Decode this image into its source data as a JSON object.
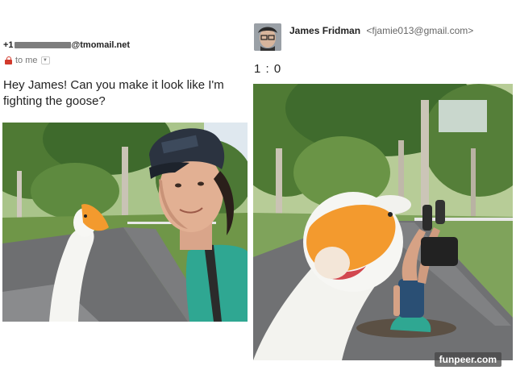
{
  "email": {
    "sender_prefix": "+1",
    "sender_suffix": "@tmomail.net",
    "to_label": "to me",
    "message": "Hey James! Can you make it look like I'm fighting the goose?"
  },
  "reply": {
    "name": "James Fridman",
    "email": "<fjamie013@gmail.com>",
    "score": "1 : 0"
  },
  "watermark": "funpeer.com",
  "icons": {
    "lock": "lock-icon",
    "dropdown": "chevron-down-icon"
  },
  "colors": {
    "lock": "#d23a2c",
    "goose_beak": "#f39a2e",
    "shirt": "#2fa792",
    "grass": "#7fa35b",
    "path": "#6e6f71"
  }
}
